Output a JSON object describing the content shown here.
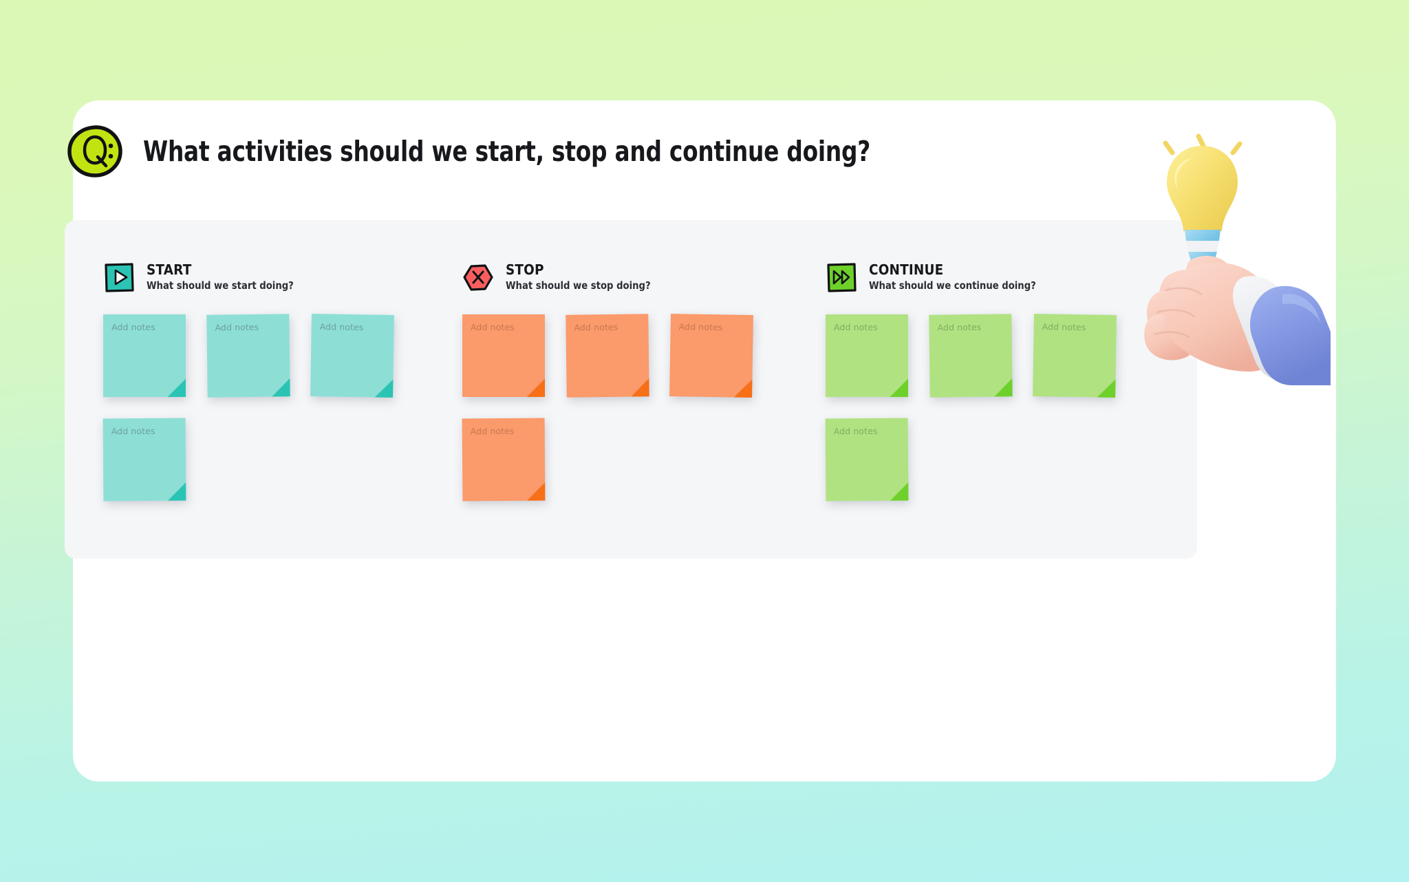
{
  "background": {
    "gradient_top": "#dcf8b5",
    "gradient_bottom": "#b2f2f0"
  },
  "card": {
    "background": "#ffffff"
  },
  "header": {
    "badge_text": "Q:",
    "badge_color": "#c2e312",
    "title": "What activities should we start, stop and continue doing?"
  },
  "panel": {
    "background": "#f5f6f8"
  },
  "note_placeholder": "Add notes",
  "columns": [
    {
      "id": "start",
      "title": "START",
      "subtitle": "What should we start doing?",
      "icon": "play-icon",
      "icon_color": "#2bc4b4",
      "note_color": "#8ddfd6",
      "note_fold_color": "#2bc4b4",
      "notes": [
        {
          "placeholder": "Add notes",
          "value": ""
        },
        {
          "placeholder": "Add notes",
          "value": ""
        },
        {
          "placeholder": "Add notes",
          "value": ""
        },
        {
          "placeholder": "Add notes",
          "value": ""
        }
      ]
    },
    {
      "id": "stop",
      "title": "STOP",
      "subtitle": "What should we stop doing?",
      "icon": "hexagon-x-icon",
      "icon_color": "#f95e5e",
      "note_color": "#fb9a6a",
      "note_fold_color": "#f76f17",
      "notes": [
        {
          "placeholder": "Add notes",
          "value": ""
        },
        {
          "placeholder": "Add notes",
          "value": ""
        },
        {
          "placeholder": "Add notes",
          "value": ""
        },
        {
          "placeholder": "Add notes",
          "value": ""
        }
      ]
    },
    {
      "id": "continue",
      "title": "CONTINUE",
      "subtitle": "What should we continue doing?",
      "icon": "fast-forward-icon",
      "icon_color": "#6ed12b",
      "note_color": "#b0e282",
      "note_fold_color": "#6ed12b",
      "notes": [
        {
          "placeholder": "Add notes",
          "value": ""
        },
        {
          "placeholder": "Add notes",
          "value": ""
        },
        {
          "placeholder": "Add notes",
          "value": ""
        },
        {
          "placeholder": "Add notes",
          "value": ""
        }
      ]
    }
  ],
  "illustration": {
    "name": "hand-holding-lightbulb",
    "bulb_color": "#f5df6a",
    "sleeve_color": "#8ba1e8",
    "cuff_color": "#eef0f3",
    "skin_color": "#f9cbbc"
  }
}
